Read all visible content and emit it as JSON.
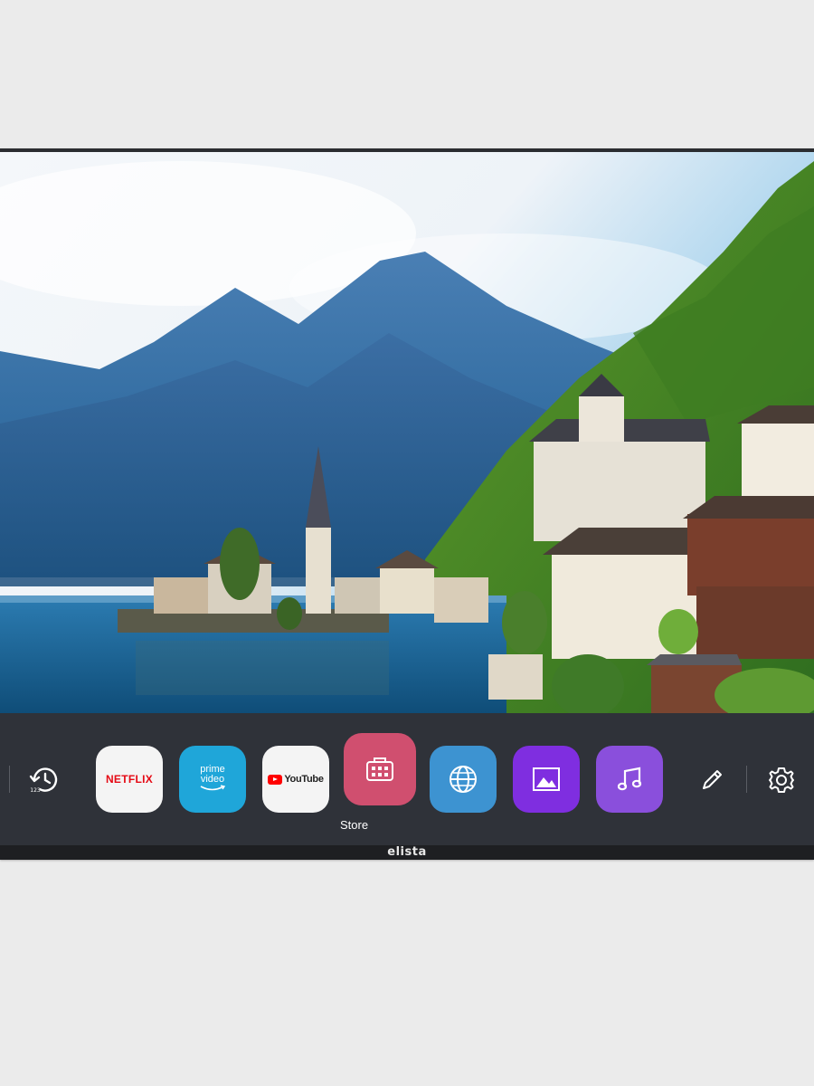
{
  "launcher": {
    "apps": [
      {
        "name": "history",
        "icon": "history-icon"
      },
      {
        "name": "netflix",
        "label": "NETFLIX"
      },
      {
        "name": "prime-video",
        "label_line1": "prime",
        "label_line2": "video"
      },
      {
        "name": "youtube",
        "label": "YouTube"
      },
      {
        "name": "store",
        "icon": "store-icon",
        "focused_label": "Store"
      },
      {
        "name": "web-browser",
        "icon": "globe-icon"
      },
      {
        "name": "gallery",
        "icon": "image-icon"
      },
      {
        "name": "music",
        "icon": "music-icon"
      },
      {
        "name": "edit",
        "icon": "pencil-icon"
      },
      {
        "name": "settings",
        "icon": "gear-icon"
      }
    ],
    "colors": {
      "bar": "#2f3239",
      "store": "#d04f6f",
      "browser": "#3d93d1",
      "gallery": "#7f2ee0",
      "music": "#8a4fdc",
      "prime": "#1fa6d9"
    }
  },
  "brand": "elista"
}
